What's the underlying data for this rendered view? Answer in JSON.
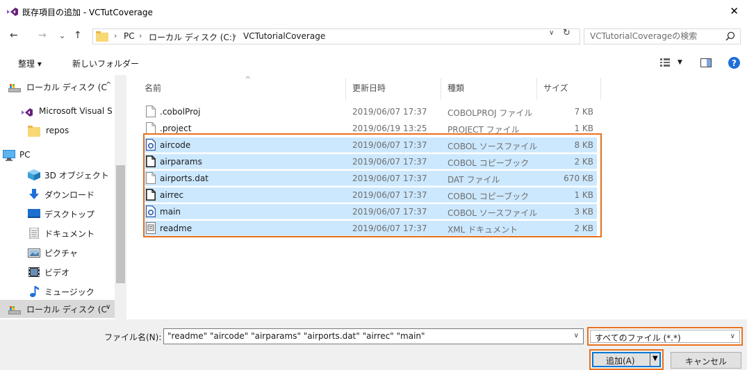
{
  "window": {
    "title": "既存項目の追加 - VCTutCoverage",
    "close_glyph": "✕"
  },
  "nav_buttons": {
    "back": "←",
    "forward": "→",
    "recent": "⌄",
    "up": "↑"
  },
  "address": {
    "crumbs": [
      "PC",
      "ローカル ディスク (C:)",
      "VCTutorialCoverage"
    ],
    "separator": "›"
  },
  "search": {
    "placeholder": "VCTutorialCoverageの検索"
  },
  "toolbar": {
    "organize": "整理 ▾",
    "new_folder": "新しいフォルダー"
  },
  "sidebar": {
    "items": [
      {
        "label": "ローカル ディスク (C",
        "icon": "drive-icon"
      },
      {
        "label": "Microsoft Visual S",
        "icon": "visual-studio-icon"
      },
      {
        "label": "repos",
        "icon": "folder-icon"
      },
      {
        "label": "PC",
        "icon": "pc-icon"
      },
      {
        "label": "3D オブジェクト",
        "icon": "3d-objects-icon"
      },
      {
        "label": "ダウンロード",
        "icon": "download-icon"
      },
      {
        "label": "デスクトップ",
        "icon": "desktop-icon"
      },
      {
        "label": "ドキュメント",
        "icon": "documents-icon"
      },
      {
        "label": "ピクチャ",
        "icon": "pictures-icon"
      },
      {
        "label": "ビデオ",
        "icon": "videos-icon"
      },
      {
        "label": "ミュージック",
        "icon": "music-icon"
      },
      {
        "label": "ローカル ディスク (C",
        "icon": "drive-icon"
      }
    ]
  },
  "columns": {
    "name": "名前",
    "date": "更新日時",
    "type": "種類",
    "size": "サイズ"
  },
  "files": [
    {
      "name": ".cobolProj",
      "date": "2019/06/07 17:37",
      "type": "COBOLPROJ ファイル",
      "size": "7 KB",
      "icon": "generic-file-icon",
      "selected": false
    },
    {
      "name": ".project",
      "date": "2019/06/19 13:25",
      "type": "PROJECT ファイル",
      "size": "1 KB",
      "icon": "generic-file-icon",
      "selected": false
    },
    {
      "name": "aircode",
      "date": "2019/06/07 17:37",
      "type": "COBOL ソースファイル",
      "size": "8 KB",
      "icon": "cobol-source-icon",
      "selected": true
    },
    {
      "name": "airparams",
      "date": "2019/06/07 17:37",
      "type": "COBOL コピーブック",
      "size": "2 KB",
      "icon": "cobol-copybook-icon",
      "selected": true
    },
    {
      "name": "airports.dat",
      "date": "2019/06/07 17:37",
      "type": "DAT ファイル",
      "size": "670 KB",
      "icon": "generic-file-icon",
      "selected": true
    },
    {
      "name": "airrec",
      "date": "2019/06/07 17:37",
      "type": "COBOL コピーブック",
      "size": "1 KB",
      "icon": "cobol-copybook-icon",
      "selected": true
    },
    {
      "name": "main",
      "date": "2019/06/07 17:37",
      "type": "COBOL ソースファイル",
      "size": "3 KB",
      "icon": "cobol-source-icon",
      "selected": true
    },
    {
      "name": "readme",
      "date": "2019/06/07 17:37",
      "type": "XML ドキュメント",
      "size": "2 KB",
      "icon": "xml-document-icon",
      "selected": true
    }
  ],
  "footer": {
    "filename_label": "ファイル名(N):",
    "filename_value": "\"readme\" \"aircode\" \"airparams\" \"airports.dat\" \"airrec\" \"main\"",
    "filter_value": "すべてのファイル (*.*)",
    "add_label": "追加(A)",
    "cancel_label": "キャンセル"
  },
  "colors": {
    "highlight": "#e8701c",
    "selection": "#cce8ff",
    "focus": "#0078d7"
  }
}
